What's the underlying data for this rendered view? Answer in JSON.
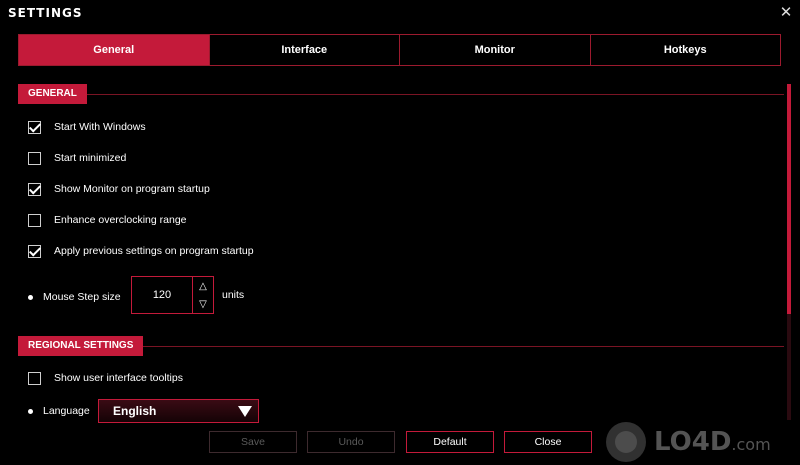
{
  "window": {
    "title": "SETTINGS",
    "close_glyph": "✕"
  },
  "tabs": [
    {
      "label": "General",
      "active": true
    },
    {
      "label": "Interface",
      "active": false
    },
    {
      "label": "Monitor",
      "active": false
    },
    {
      "label": "Hotkeys",
      "active": false
    }
  ],
  "general": {
    "header": "GENERAL",
    "options": [
      {
        "label": "Start With Windows",
        "checked": true
      },
      {
        "label": "Start minimized",
        "checked": false
      },
      {
        "label": "Show Monitor on program startup",
        "checked": true
      },
      {
        "label": "Enhance overclocking range",
        "checked": false
      },
      {
        "label": "Apply previous settings on program startup",
        "checked": true
      }
    ],
    "mouse_step": {
      "label": "Mouse Step size",
      "value": "120",
      "units": "units",
      "up": "△",
      "down": "▽"
    }
  },
  "regional": {
    "header": "REGIONAL SETTINGS",
    "tooltips": {
      "label": "Show user interface tooltips",
      "checked": false
    },
    "language": {
      "label": "Language",
      "value": "English"
    }
  },
  "buttons": {
    "save": "Save",
    "undo": "Undo",
    "default": "Default",
    "close": "Close"
  },
  "watermark": {
    "brand": "LO4D",
    "suffix": ".com"
  },
  "colors": {
    "accent": "#c41a3a",
    "background": "#000000"
  },
  "scrollbar": {
    "position_fraction": 0
  }
}
